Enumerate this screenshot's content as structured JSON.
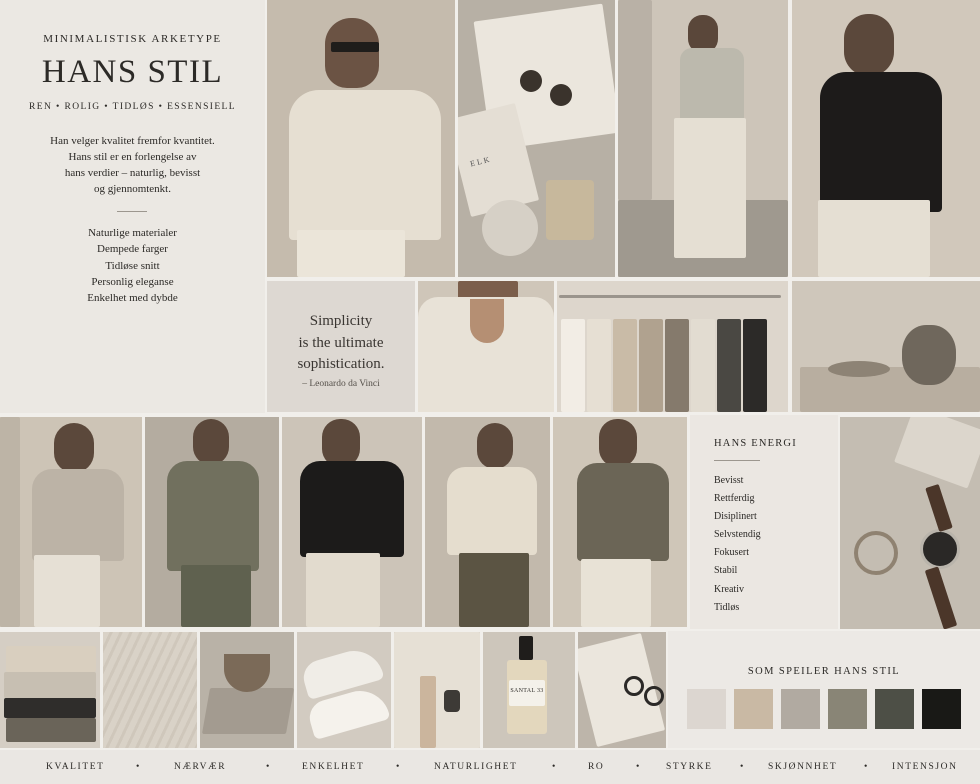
{
  "title_panel": {
    "kicker": "MINIMALISTISK ARKETYPE",
    "headline": "HANS STIL",
    "tags": "REN  •  ROLIG  •  TIDLØS  •  ESSENSIELL",
    "lead_lines": [
      "Han velger kvalitet fremfor kvantitet.",
      "Hans stil er en forlengelse av",
      "hans verdier – naturlig, bevisst",
      "og gjennomtenkt."
    ],
    "qualities": [
      "Naturlige materialer",
      "Dempede farger",
      "Tidløse snitt",
      "Personlig eleganse",
      "Enkelhet med dybde"
    ]
  },
  "quote": {
    "lines": [
      "Simplicity",
      "is the ultimate",
      "sophistication."
    ],
    "author": "– Leonardo da Vinci"
  },
  "energy": {
    "title": "HANS ENERGI",
    "items": [
      "Bevisst",
      "Rettferdig",
      "Disiplinert",
      "Selvstendig",
      "Fokusert",
      "Stabil",
      "Kreativ",
      "Tidløs"
    ]
  },
  "palette": {
    "title": "SOM SPEILER HANS STIL",
    "swatches": [
      "#dcd6d0",
      "#c9b9a4",
      "#b1aaa1",
      "#898576",
      "#4d4f46",
      "#191916"
    ]
  },
  "perfume_label": "SANTAL 33",
  "book_label": "ELK",
  "footer": [
    "KVALITET",
    "NÆRVÆR",
    "ENKELHET",
    "NATURLIGHET",
    "RO",
    "STYRKE",
    "SKJØNNHET",
    "INTENSJON"
  ],
  "colors": {
    "background": "#f1efeb",
    "text": "#2c2a27",
    "stone": "#cfc7bc",
    "linen": "#e6e0d6"
  }
}
